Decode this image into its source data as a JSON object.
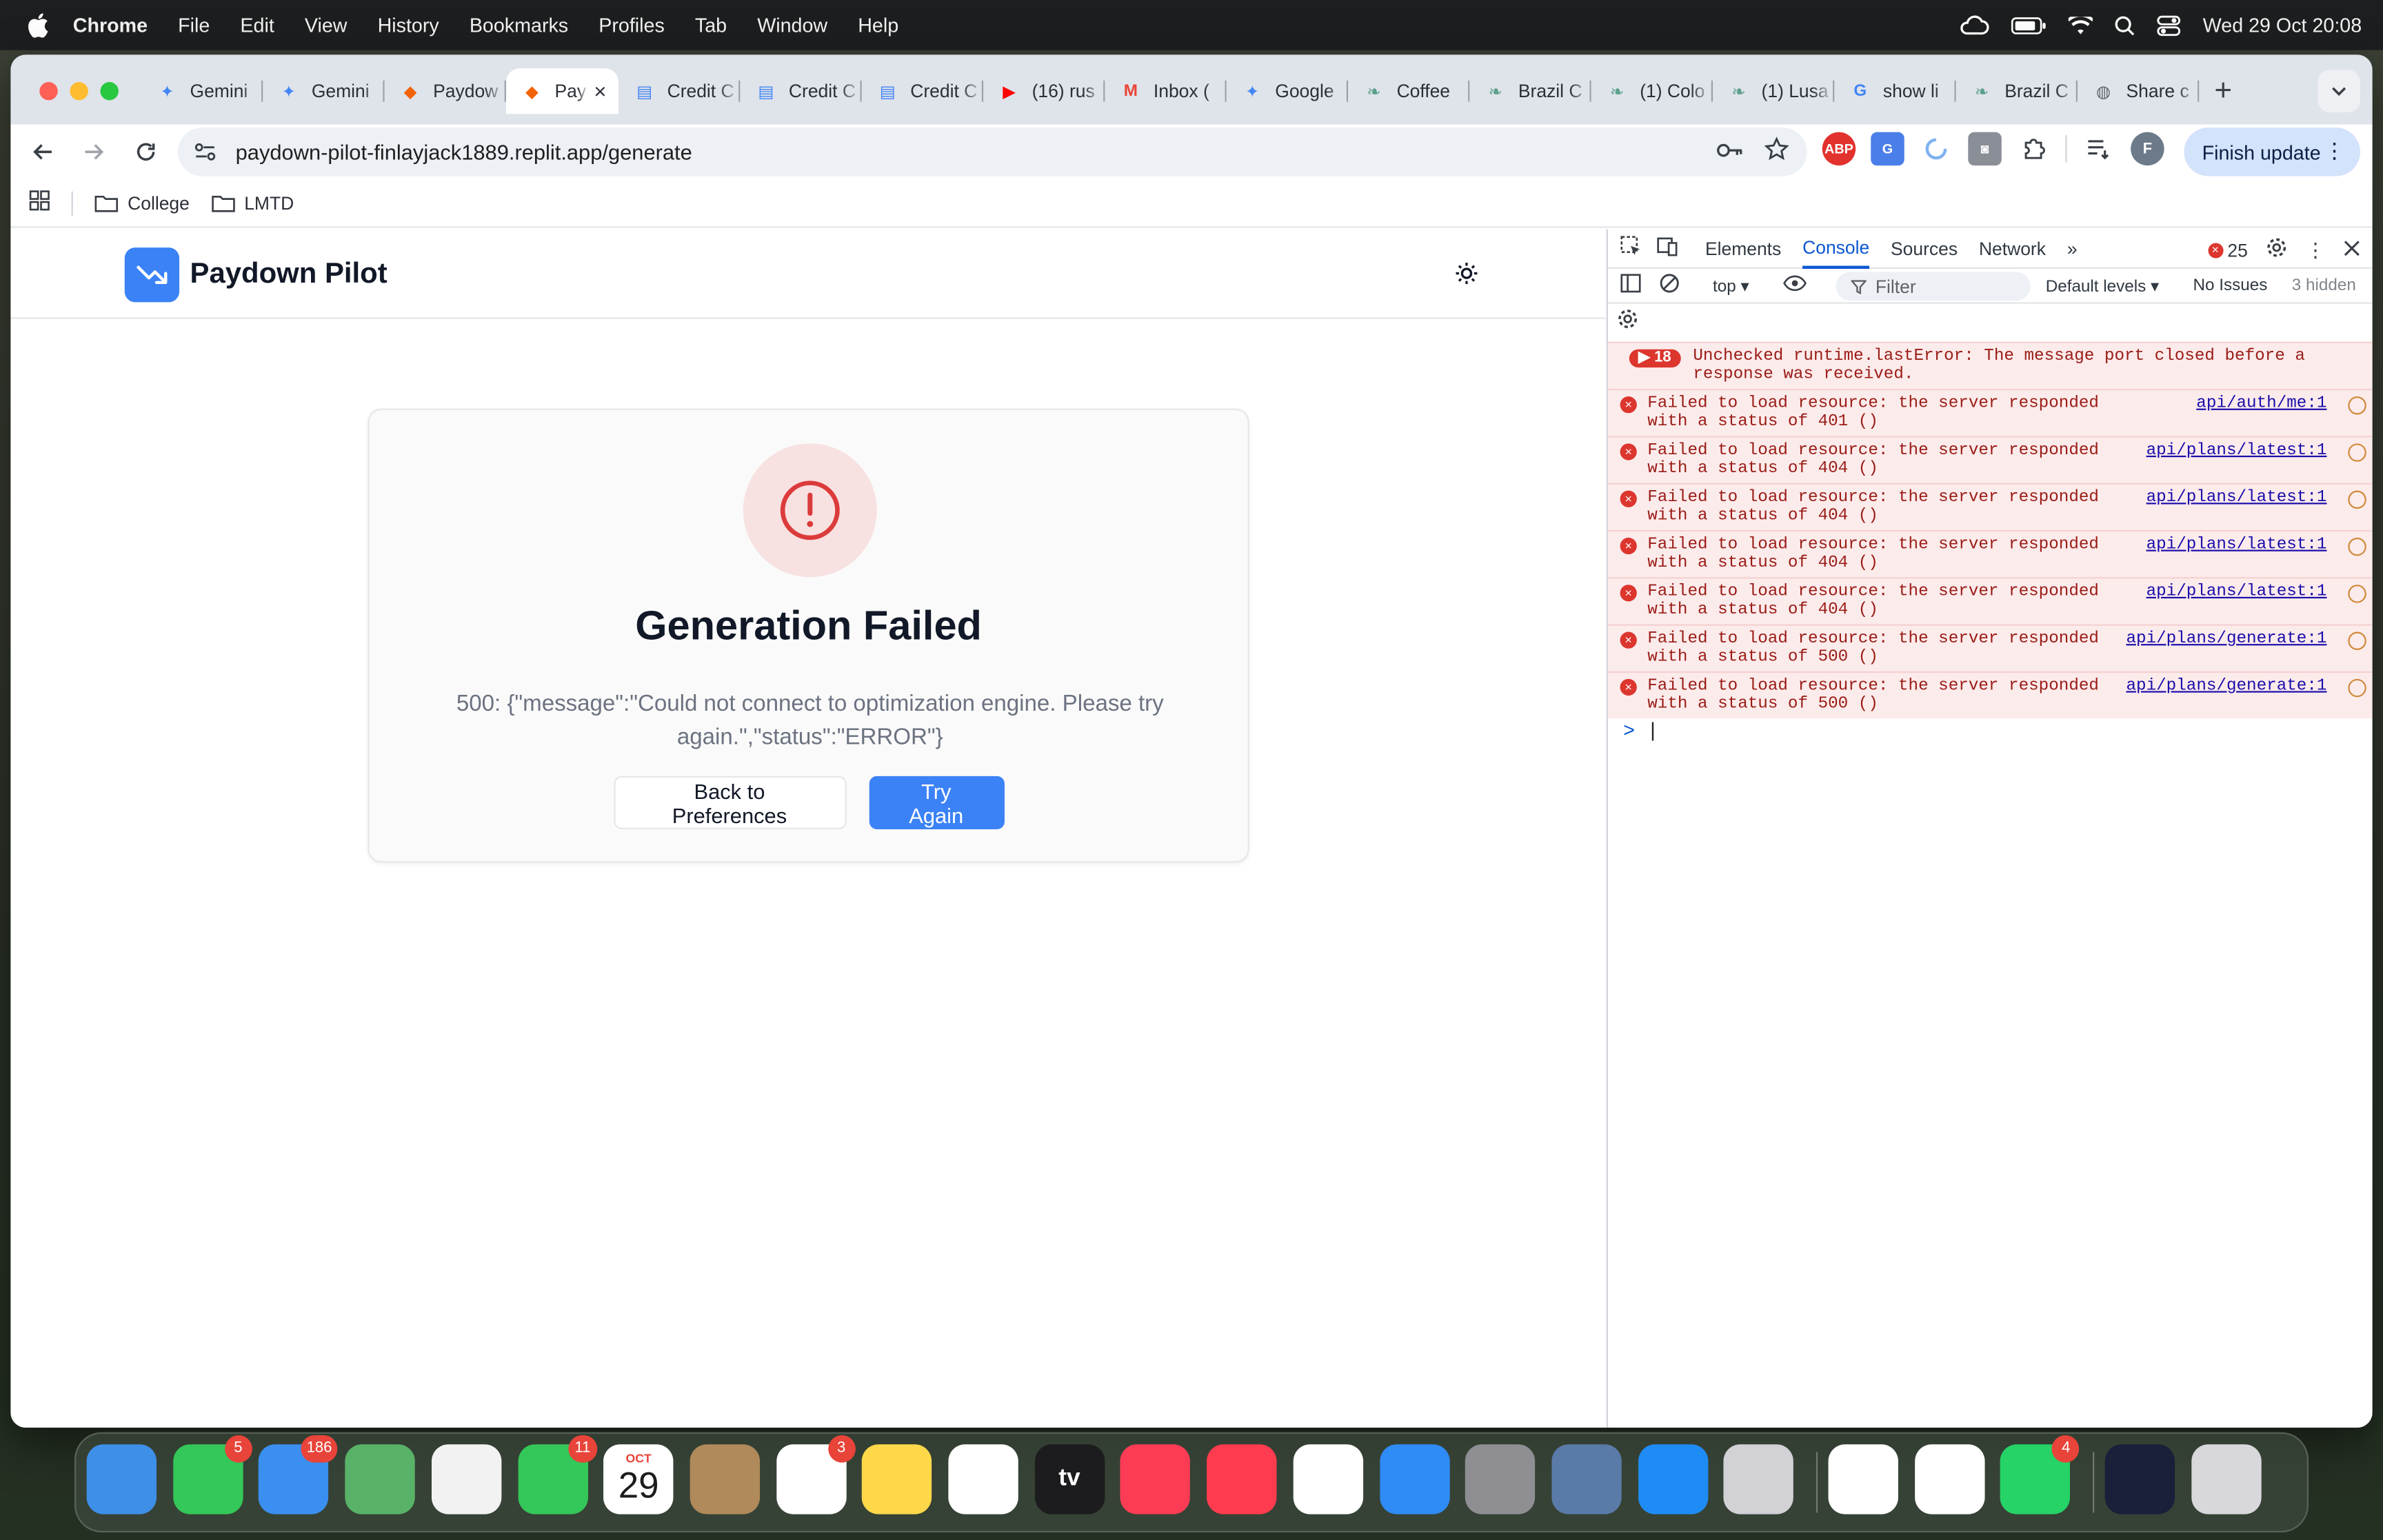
{
  "menubar": {
    "app": "Chrome",
    "items": [
      "File",
      "Edit",
      "View",
      "History",
      "Bookmarks",
      "Profiles",
      "Tab",
      "Window",
      "Help"
    ],
    "clock": "Wed 29 Oct  20:08"
  },
  "tabs": [
    {
      "title": "Gemini",
      "icon": "gemini-icon",
      "color": "#4285f4"
    },
    {
      "title": "Gemini",
      "icon": "gemini-icon",
      "color": "#4285f4"
    },
    {
      "title": "Paydow",
      "icon": "replit-icon",
      "color": "#f26207"
    },
    {
      "title": "Pay",
      "icon": "replit-icon",
      "color": "#f26207",
      "active": true
    },
    {
      "title": "Credit C",
      "icon": "docs-icon",
      "color": "#4285f4"
    },
    {
      "title": "Credit C",
      "icon": "docs-icon",
      "color": "#4285f4"
    },
    {
      "title": "Credit C",
      "icon": "docs-icon",
      "color": "#4285f4"
    },
    {
      "title": "(16) rus",
      "icon": "youtube-icon",
      "color": "#ff0000"
    },
    {
      "title": "Inbox (",
      "icon": "gmail-icon",
      "color": "#ea4335"
    },
    {
      "title": "Google",
      "icon": "gemini-icon",
      "color": "#4285f4"
    },
    {
      "title": "Coffee",
      "icon": "leaf-icon",
      "color": "#5ba08a"
    },
    {
      "title": "Brazil C",
      "icon": "leaf-icon",
      "color": "#5ba08a"
    },
    {
      "title": "(1) Colo",
      "icon": "leaf-icon",
      "color": "#5ba08a"
    },
    {
      "title": "(1) Lusa",
      "icon": "leaf-icon",
      "color": "#5ba08a"
    },
    {
      "title": "show li",
      "icon": "google-icon",
      "color": "#4285f4"
    },
    {
      "title": "Brazil C",
      "icon": "leaf-icon",
      "color": "#5ba08a"
    },
    {
      "title": "Share c",
      "icon": "globe-icon",
      "color": "#5f6368"
    }
  ],
  "toolbar": {
    "url": "paydown-pilot-finlayjack1889.replit.app/generate",
    "finish_update": "Finish update"
  },
  "bookmarks": [
    "College",
    "LMTD"
  ],
  "app": {
    "brand": "Paydown Pilot",
    "title": "Generation Failed",
    "message": "500: {\"message\":\"Could not connect to optimization engine. Please try again.\",\"status\":\"ERROR\"}",
    "back_label": "Back to Preferences",
    "retry_label": "Try Again",
    "accent": "#3b82f6",
    "error_color": "#dc3b3b"
  },
  "devtools": {
    "tabs": [
      "Elements",
      "Console",
      "Sources",
      "Network"
    ],
    "active_tab": "Console",
    "error_count": "25",
    "context": "top",
    "filter_placeholder": "Filter",
    "levels": "Default levels",
    "issues": "No Issues",
    "hidden": "3 hidden",
    "messages": [
      {
        "count": "18",
        "text": "Unchecked runtime.lastError: The message port closed before a response was received.",
        "source": ""
      },
      {
        "text": "Failed to load resource: the server responded with a status of 401 ()",
        "source": "api/auth/me:1"
      },
      {
        "text": "Failed to load resource: the server responded with a status of 404 ()",
        "source": "api/plans/latest:1"
      },
      {
        "text": "Failed to load resource: the server responded with a status of 404 ()",
        "source": "api/plans/latest:1"
      },
      {
        "text": "Failed to load resource: the server responded with a status of 404 ()",
        "source": "api/plans/latest:1"
      },
      {
        "text": "Failed to load resource: the server responded with a status of 404 ()",
        "source": "api/plans/latest:1"
      },
      {
        "text": "Failed to load resource: the server responded with a status of 500 ()",
        "source": "api/plans/generate:1"
      },
      {
        "text": "Failed to load resource: the server responded with a status of 500 ()",
        "source": "api/plans/generate:1"
      }
    ],
    "prompt": ">"
  },
  "dock": [
    {
      "name": "finder-icon",
      "color": "#3d8fe8",
      "badge": ""
    },
    {
      "name": "messages-icon",
      "color": "#34c759",
      "badge": "5"
    },
    {
      "name": "mail-icon",
      "color": "#3b8ff0",
      "badge": "186"
    },
    {
      "name": "maps-icon",
      "color": "#58b368",
      "badge": ""
    },
    {
      "name": "photos-icon",
      "color": "#f2f2f2",
      "badge": ""
    },
    {
      "name": "facetime-icon",
      "color": "#34c759",
      "badge": "11"
    },
    {
      "name": "calendar-icon",
      "color": "#ffffff",
      "badge": "",
      "month": "OCT",
      "day": "29"
    },
    {
      "name": "contacts-icon",
      "color": "#b08a5a",
      "badge": ""
    },
    {
      "name": "reminders-icon",
      "color": "#ffffff",
      "badge": "3"
    },
    {
      "name": "notes-icon",
      "color": "#ffd84a",
      "badge": ""
    },
    {
      "name": "freeform-icon",
      "color": "#ffffff",
      "badge": ""
    },
    {
      "name": "apple-tv-icon",
      "color": "#1c1c1e",
      "badge": "",
      "label": "tv"
    },
    {
      "name": "music-icon",
      "color": "#fb3c54",
      "badge": ""
    },
    {
      "name": "news-icon",
      "color": "#ff3b4f",
      "badge": ""
    },
    {
      "name": "chrome-icon",
      "color": "#ffffff",
      "badge": ""
    },
    {
      "name": "safari-icon",
      "color": "#2f8bf5",
      "badge": ""
    },
    {
      "name": "system-settings-icon",
      "color": "#8e8e93",
      "badge": ""
    },
    {
      "name": "preview-icon",
      "color": "#5a7aa8",
      "badge": ""
    },
    {
      "name": "app-store-icon",
      "color": "#1f8cf5",
      "badge": ""
    },
    {
      "name": "iphone-mirroring-icon",
      "color": "#d1d1d6",
      "badge": ""
    },
    {
      "name": "infuse-icon",
      "color": "#ffffff",
      "badge": ""
    },
    {
      "name": "passwords-icon",
      "color": "#ffffff",
      "badge": ""
    },
    {
      "name": "whatsapp-icon",
      "color": "#25d366",
      "badge": "4"
    },
    {
      "name": "recent-window-icon",
      "color": "#1a1f3a",
      "badge": ""
    },
    {
      "name": "trash-icon",
      "color": "#d8d8dc",
      "badge": ""
    }
  ]
}
